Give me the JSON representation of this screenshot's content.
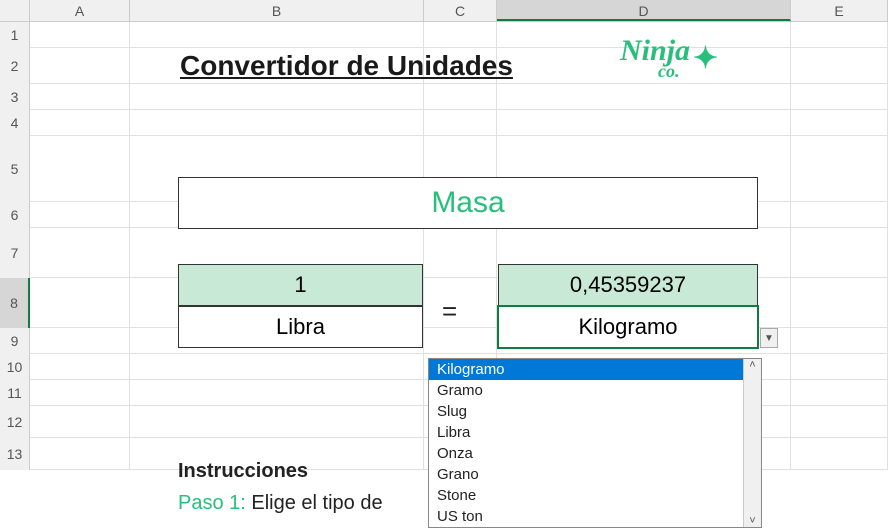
{
  "columns": [
    "A",
    "B",
    "C",
    "D",
    "E"
  ],
  "rows": [
    "1",
    "2",
    "3",
    "4",
    "5",
    "6",
    "7",
    "8",
    "9",
    "10",
    "11",
    "12",
    "13"
  ],
  "selected_column": "D",
  "selected_row": "8",
  "title": "Convertidor de Unidades",
  "logo": {
    "main": "Ninja",
    "sub": "co.",
    "sparkle": "✦"
  },
  "category": "Masa",
  "input_value": "1",
  "input_unit": "Libra",
  "equals": "=",
  "output_value": "0,45359237",
  "output_unit": "Kilogramo",
  "dropdown": {
    "selected": "Kilogramo",
    "options": [
      "Kilogramo",
      "Gramo",
      "Slug",
      "Libra",
      "Onza",
      "Grano",
      "Stone",
      "US ton"
    ]
  },
  "instructions": {
    "heading": "Instrucciones",
    "step1_label": "Paso 1:",
    "step1_text": "  Elige el tipo de"
  }
}
